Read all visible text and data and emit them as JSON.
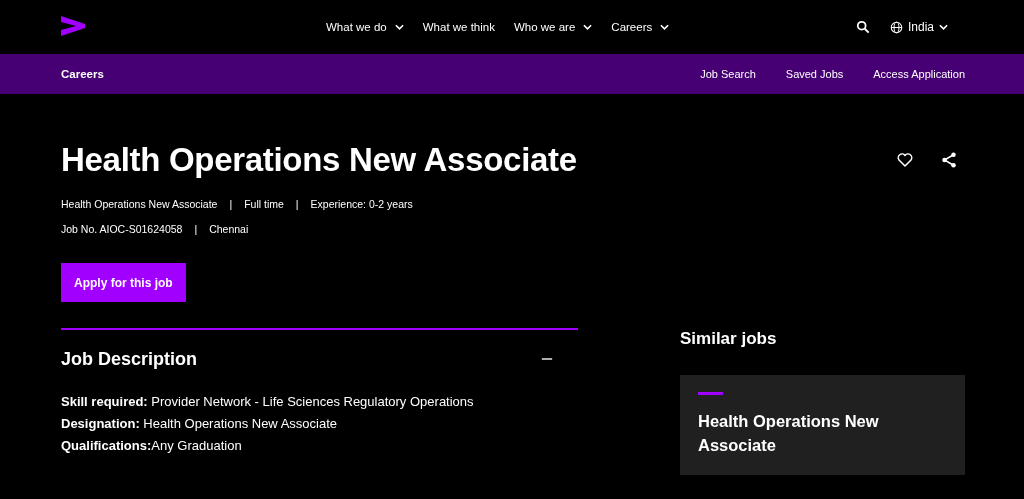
{
  "top_nav": {
    "items": [
      {
        "label": "What we do",
        "dropdown": true
      },
      {
        "label": "What we think",
        "dropdown": false
      },
      {
        "label": "Who we are",
        "dropdown": true
      },
      {
        "label": "Careers",
        "dropdown": true
      }
    ],
    "region": "India"
  },
  "sub_nav": {
    "title": "Careers",
    "links": [
      "Job Search",
      "Saved Jobs",
      "Access Application"
    ]
  },
  "job": {
    "title": "Health Operations New Associate",
    "separator": "|",
    "meta_lines": [
      [
        "Health Operations New Associate",
        "Full time",
        "Experience: 0-2 years"
      ],
      [
        "Job No. AIOC-S01624058",
        "Chennai"
      ]
    ],
    "apply_button": "Apply for this job"
  },
  "description": {
    "heading": "Job Description",
    "expanded": true,
    "lines": [
      "**Skill required:** Provider Network - Life Sciences Regulatory Operations",
      "**Designation:** Health Operations New Associate",
      "**Qualifications:**Any Graduation"
    ]
  },
  "similar_jobs": {
    "heading": "Similar jobs",
    "cards": [
      {
        "title": "Health Operations New Associate"
      }
    ]
  }
}
